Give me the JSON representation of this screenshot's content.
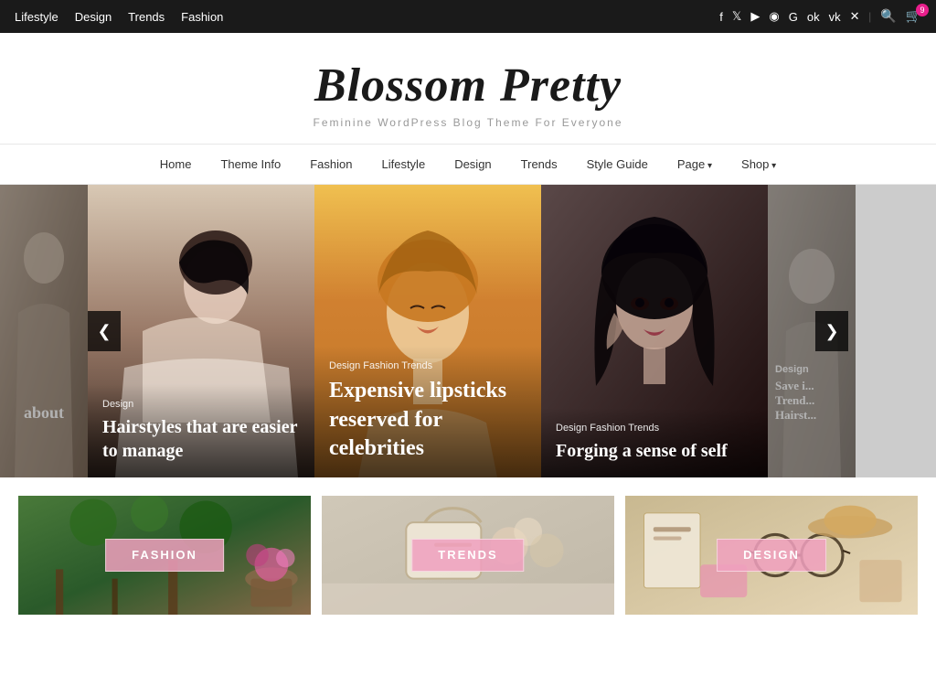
{
  "topNav": {
    "links": [
      "Lifestyle",
      "Design",
      "Trends",
      "Fashion"
    ],
    "socialIcons": [
      "f",
      "t",
      "▶",
      "◉",
      "g+",
      "ok",
      "vk",
      "×"
    ],
    "cartCount": "9"
  },
  "header": {
    "title": "Blossom Pretty",
    "tagline": "Feminine WordPress Blog Theme For Everyone"
  },
  "mainNav": {
    "items": [
      {
        "label": "Home",
        "hasDropdown": false
      },
      {
        "label": "Theme Info",
        "hasDropdown": false
      },
      {
        "label": "Fashion",
        "hasDropdown": false
      },
      {
        "label": "Lifestyle",
        "hasDropdown": false
      },
      {
        "label": "Design",
        "hasDropdown": false
      },
      {
        "label": "Trends",
        "hasDropdown": false
      },
      {
        "label": "Style Guide",
        "hasDropdown": false
      },
      {
        "label": "Page",
        "hasDropdown": true
      },
      {
        "label": "Shop",
        "hasDropdown": true
      }
    ]
  },
  "slider": {
    "prevLabel": "❮",
    "nextLabel": "❯",
    "slides": [
      {
        "id": "far-left",
        "overlayText": "about"
      },
      {
        "id": "left",
        "category": "Design",
        "title": "Hairstyles that are easier to manage"
      },
      {
        "id": "center",
        "category": "Design Fashion Trends",
        "title": "Expensive lipsticks reserved for celebrities"
      },
      {
        "id": "right",
        "category": "Design Fashion Trends",
        "title": "Forging a sense of self"
      },
      {
        "id": "far-right",
        "overlayText": "Save i... Trend... Hairst..."
      }
    ]
  },
  "categories": [
    {
      "label": "FASHION"
    },
    {
      "label": "TRENDS"
    },
    {
      "label": "DESIGN"
    }
  ]
}
